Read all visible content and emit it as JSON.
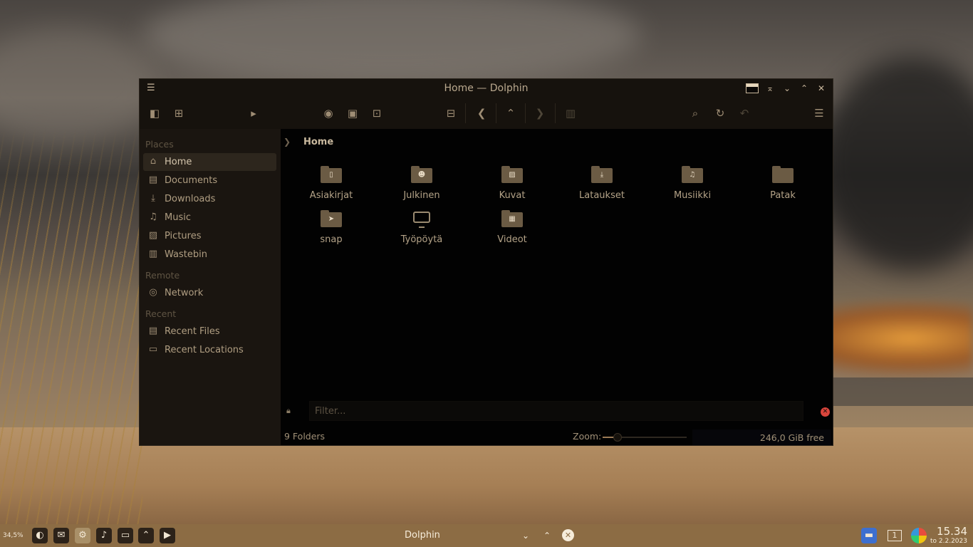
{
  "window": {
    "title": "Home — Dolphin"
  },
  "sidebar": {
    "sections": {
      "places": "Places",
      "remote": "Remote",
      "recent": "Recent"
    },
    "items": [
      {
        "label": "Home",
        "icon": "home-icon"
      },
      {
        "label": "Documents",
        "icon": "document-icon"
      },
      {
        "label": "Downloads",
        "icon": "download-icon"
      },
      {
        "label": "Music",
        "icon": "music-icon"
      },
      {
        "label": "Pictures",
        "icon": "picture-icon"
      },
      {
        "label": "Wastebin",
        "icon": "trash-icon"
      },
      {
        "label": "Network",
        "icon": "network-icon"
      },
      {
        "label": "Recent Files",
        "icon": "recent-files-icon"
      },
      {
        "label": "Recent Locations",
        "icon": "recent-locations-icon"
      }
    ]
  },
  "breadcrumb": {
    "current": "Home"
  },
  "files": [
    {
      "name": "Asiakirjat",
      "emblem": "document"
    },
    {
      "name": "Julkinen",
      "emblem": "people"
    },
    {
      "name": "Kuvat",
      "emblem": "picture"
    },
    {
      "name": "Lataukset",
      "emblem": "download"
    },
    {
      "name": "Musiikki",
      "emblem": "music"
    },
    {
      "name": "Patak",
      "emblem": "none"
    },
    {
      "name": "snap",
      "emblem": "snap"
    },
    {
      "name": "Työpöytä",
      "emblem": "desktop"
    },
    {
      "name": "Videot",
      "emblem": "video"
    }
  ],
  "filter": {
    "placeholder": "Filter..."
  },
  "status": {
    "folders": "9 Folders",
    "zoom_label": "Zoom:",
    "zoom_level": 0.18,
    "free_space": "246,0 GiB free"
  },
  "taskbar": {
    "battery": "34,5%",
    "active_task": "Dolphin",
    "desktop_number": "1",
    "time": "15.34",
    "date": "to 2.2.2023"
  },
  "colors": {
    "accent": "#6b5b44",
    "taskbar": "#8c6c44",
    "window_bg": "#020202",
    "sidebar_bg": "#1a1510",
    "close_red": "#d9453c"
  }
}
